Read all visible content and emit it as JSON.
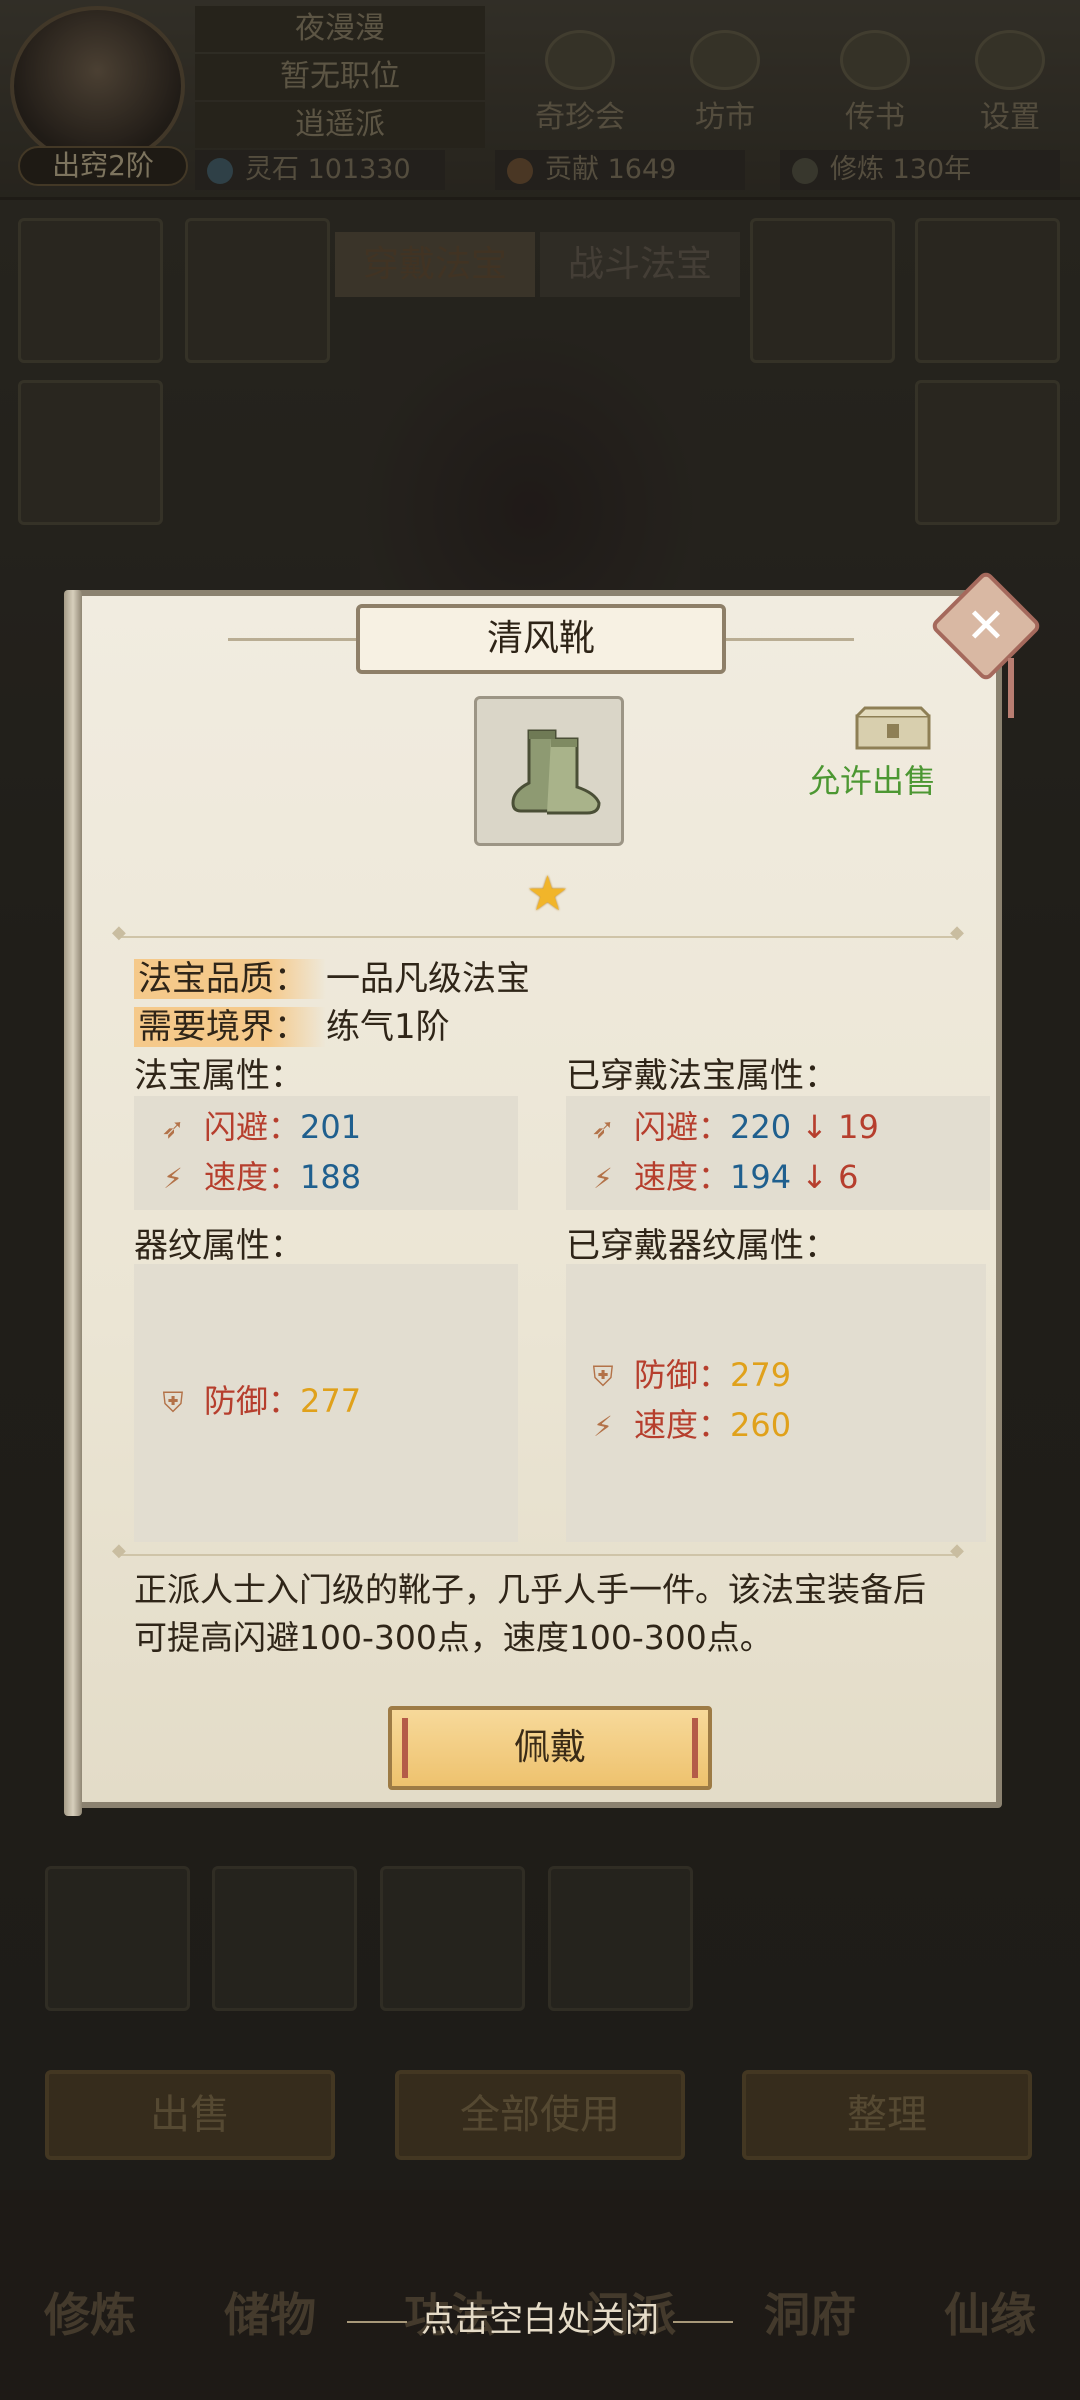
{
  "player": {
    "name": "夜漫漫",
    "position": "暂无职位",
    "sect": "逍遥派",
    "realm": "出窍2阶"
  },
  "top_menu": [
    "奇珍会",
    "坊市",
    "传书",
    "设置"
  ],
  "resources": {
    "spirit_stone": "灵石 101330",
    "contribution": "贡献 1649",
    "cultivation": "修炼 130年"
  },
  "equip_tabs": [
    "穿戴法宝",
    "战斗法宝"
  ],
  "bottom_buttons": [
    "出售",
    "全部使用",
    "整理"
  ],
  "nav": [
    "修炼",
    "储物",
    "功法",
    "门派",
    "洞府",
    "仙缘"
  ],
  "close_hint": "点击空白处关闭",
  "modal": {
    "title": "清风靴",
    "sellable": "允许出售",
    "stars": 1,
    "quality_label": "法宝品质：",
    "quality_value": "一品凡级法宝",
    "realm_label": "需要境界：",
    "realm_value": "练气1阶",
    "treasure_attr_header": "法宝属性：",
    "worn_attr_header": "已穿戴法宝属性：",
    "pattern_header": "器纹属性：",
    "worn_pattern_header": "已穿戴器纹属性：",
    "treasure_stats": [
      {
        "name": "闪避：",
        "value": "201",
        "icon": "dodge-icon"
      },
      {
        "name": "速度：",
        "value": "188",
        "icon": "speed-icon"
      }
    ],
    "worn_stats": [
      {
        "name": "闪避：",
        "value": "220",
        "diff": "↓ 19"
      },
      {
        "name": "速度：",
        "value": "194",
        "diff": "↓ 6"
      }
    ],
    "pattern_stats": [
      {
        "name": "防御：",
        "value": "277"
      }
    ],
    "worn_pattern_stats": [
      {
        "name": "防御：",
        "value": "279"
      },
      {
        "name": "速度：",
        "value": "260"
      }
    ],
    "description": "正派人士入门级的靴子，几乎人手一件。该法宝装备后可提高闪避100-300点，速度100-300点。",
    "equip_button": "佩戴"
  },
  "colors": {
    "stat_name": "#b63e2d",
    "stat_value": "#1f5f8e",
    "pattern_value": "#e0a11b",
    "sellable": "#4c9732",
    "star": "#f1b52a"
  }
}
